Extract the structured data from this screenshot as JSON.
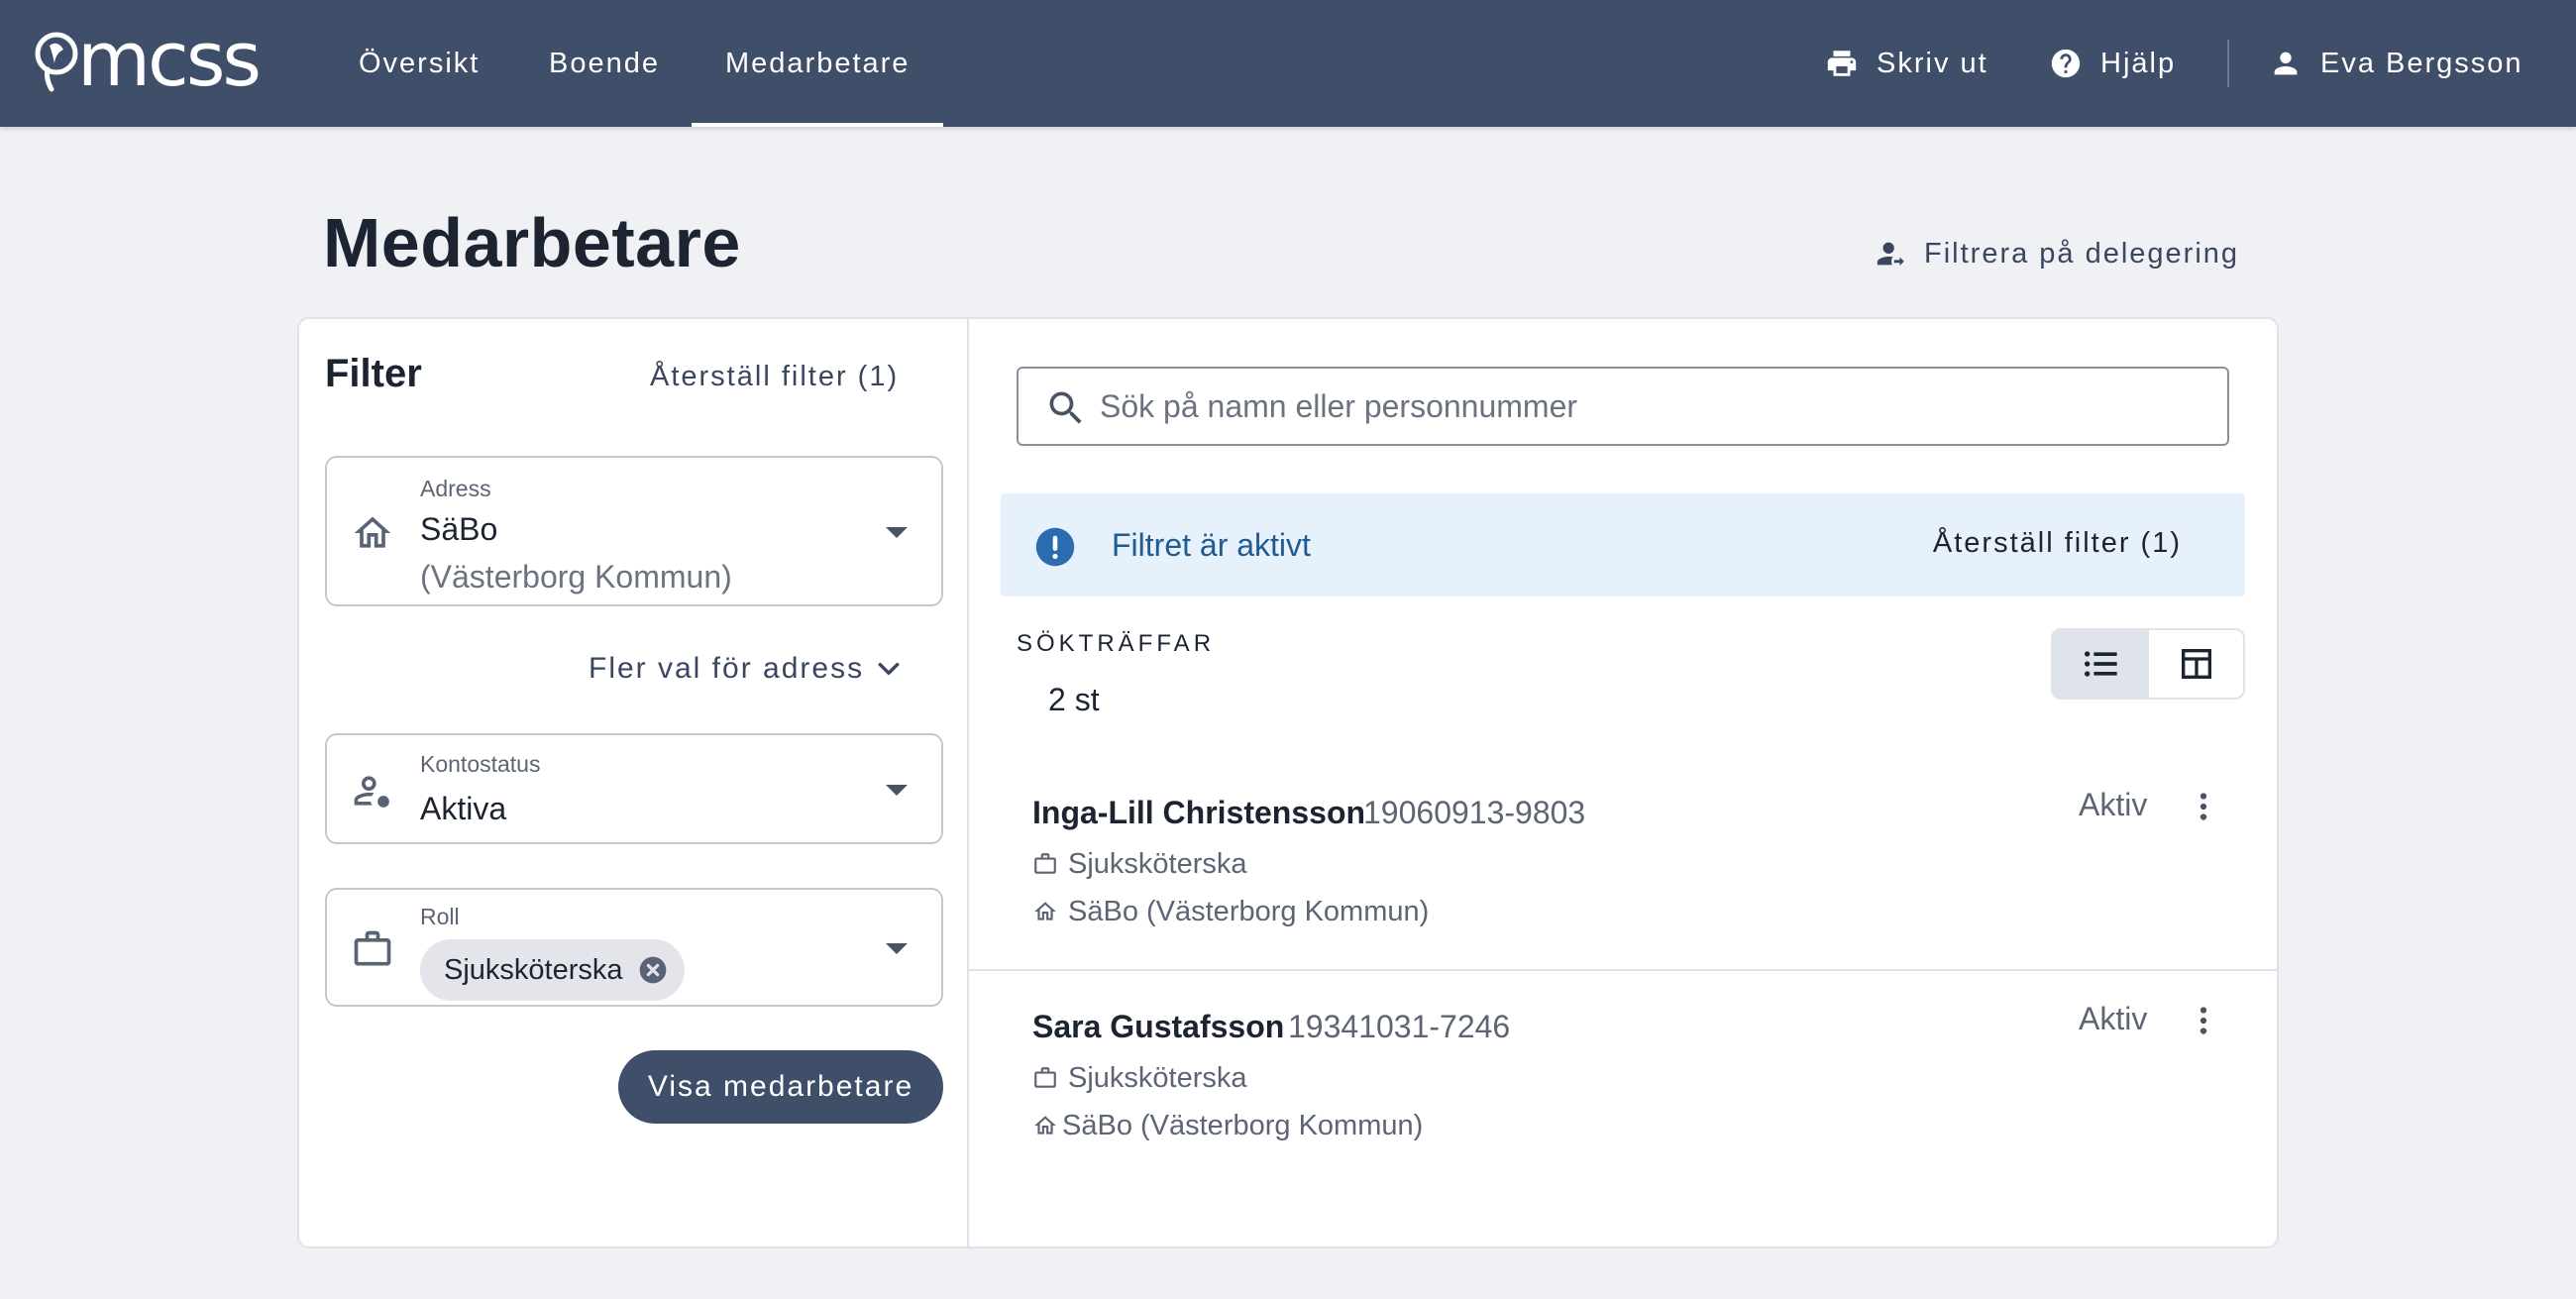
{
  "brand": {
    "logo_text": "mcss"
  },
  "nav": {
    "items": [
      {
        "label": "Översikt"
      },
      {
        "label": "Boende"
      },
      {
        "label": "Medarbetare"
      }
    ],
    "active": "Medarbetare"
  },
  "header_actions": {
    "print_label": "Skriv ut",
    "help_label": "Hjälp",
    "user_name": "Eva Bergsson"
  },
  "page": {
    "title": "Medarbetare",
    "delegation_filter_label": "Filtrera på delegering"
  },
  "filter": {
    "heading": "Filter",
    "reset_label": "Återställ filter (1)",
    "address": {
      "label": "Adress",
      "value_line1": "SäBo",
      "value_line2": "(Västerborg Kommun)",
      "icon": "home-icon"
    },
    "more_address_label": "Fler val för adress",
    "account_status": {
      "label": "Kontostatus",
      "value": "Aktiva",
      "icon": "person-status-icon"
    },
    "role": {
      "label": "Roll",
      "chip": "Sjuksköterska",
      "icon": "briefcase-icon"
    },
    "submit_label": "Visa medarbetare"
  },
  "search": {
    "placeholder": "Sök på namn eller personnummer",
    "value": ""
  },
  "alert": {
    "text": "Filtret är aktivt",
    "reset_label": "Återställ filter (1)"
  },
  "results": {
    "hits_label": "SÖKTRÄFFAR",
    "hits_count": "2 st",
    "view_modes": [
      "list",
      "table"
    ],
    "active_view": "list",
    "items": [
      {
        "name": "Inga-Lill Christensson",
        "personnummer": "19060913-9803",
        "role": "Sjuksköterska",
        "address": "SäBo (Västerborg Kommun)",
        "status": "Aktiv"
      },
      {
        "name": "Sara Gustafsson",
        "personnummer": "19341031-7246",
        "role": "Sjuksköterska",
        "address": "SäBo (Västerborg Kommun)",
        "status": "Aktiv"
      }
    ]
  },
  "colors": {
    "header_bg": "#3f4e69",
    "page_bg": "#f0f1f5",
    "alert_bg": "#e6f1fb",
    "alert_icon": "#2b6cb0",
    "primary_button": "#3f4e69"
  }
}
